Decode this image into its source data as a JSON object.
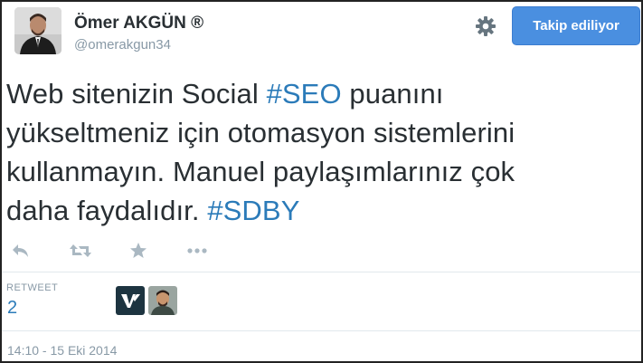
{
  "profile": {
    "name": "Ömer AKGÜN ®",
    "handle": "@omerakgun34"
  },
  "follow_button": {
    "label": "Takip ediliyor",
    "color": "#4a8fe0"
  },
  "tweet": {
    "lines": [
      [
        {
          "text": "Web sitenizin Social ",
          "hashtag": false
        },
        {
          "text": "#SEO",
          "hashtag": true
        },
        {
          "text": " puanını",
          "hashtag": false
        }
      ],
      [
        {
          "text": "yükseltmeniz için otomasyon sistemlerini",
          "hashtag": false
        }
      ],
      [
        {
          "text": "kullanmayın. Manuel paylaşımlarınız çok",
          "hashtag": false
        }
      ],
      [
        {
          "text": "daha faydalıdır. ",
          "hashtag": false
        },
        {
          "text": "#SDBY",
          "hashtag": true
        }
      ]
    ],
    "hashtag_color": "#2b7bb9"
  },
  "actions": [
    {
      "name": "reply-icon"
    },
    {
      "name": "retweet-icon"
    },
    {
      "name": "favorite-icon"
    },
    {
      "name": "more-icon"
    }
  ],
  "stats": {
    "retweet_label": "RETWEET",
    "retweet_count": "2"
  },
  "retweeters": [
    {
      "name": "retweeter-avatar-brand-logo"
    },
    {
      "name": "retweeter-avatar-person"
    }
  ],
  "timestamp": "14:10 - 15 Eki 2014",
  "icons": {
    "settings": "gear-icon"
  }
}
